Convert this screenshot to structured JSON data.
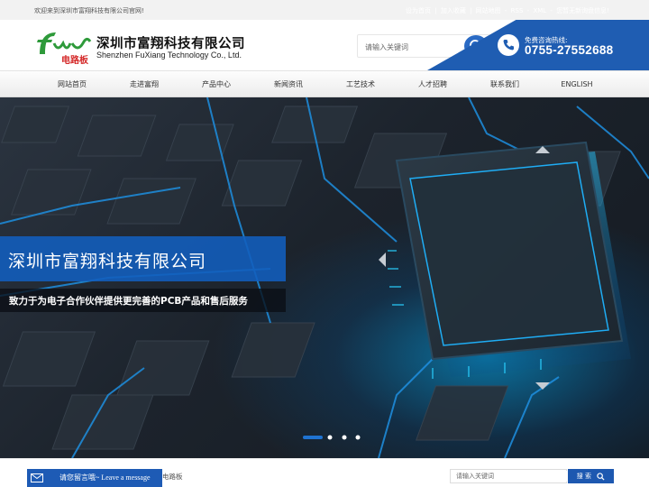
{
  "topbar": {
    "welcome": "欢迎来到深圳市富翔科技有限公司官网!",
    "links": [
      "设为首页",
      "加入收藏",
      "网站地图",
      "RSS",
      "XML",
      "您暂无新询盘信息!"
    ]
  },
  "header": {
    "logo_text": "电路板",
    "logo_mark": "Fuw",
    "company_cn": "深圳市富翔科技有限公司",
    "company_en": "Shenzhen  FuXiang Technology Co., Ltd.",
    "search_placeholder": "请输入关键词",
    "hotline_label": "免费咨询热线:",
    "hotline_number": "0755-27552688"
  },
  "nav": {
    "items": [
      "网站首页",
      "走进富翔",
      "产品中心",
      "新闻资讯",
      "工艺技术",
      "人才招聘",
      "联系我们",
      "ENGLISH"
    ]
  },
  "banner": {
    "title": "深圳市富翔科技有限公司",
    "subtitle": "致力于为电子合作伙伴提供更完善的PCB产品和售后服务",
    "slides": 4,
    "active_slide": 1
  },
  "bottom": {
    "hot_keyword": "电路板",
    "search_placeholder": "请输入关键词",
    "search_button": "搜 索",
    "message_bar": "请您留言哦~ Leave a message"
  },
  "colors": {
    "brand_blue": "#1f5db2",
    "logo_green": "#2e9a3a",
    "logo_red": "#d52b2b"
  }
}
